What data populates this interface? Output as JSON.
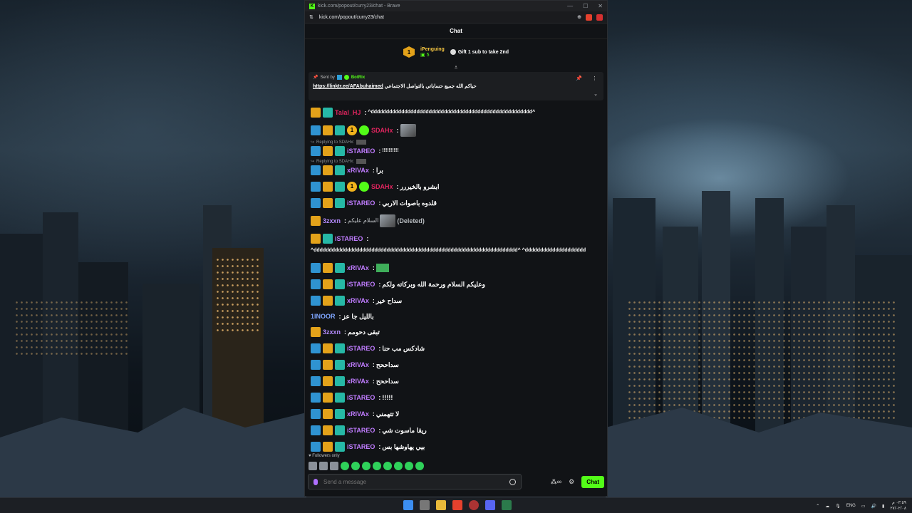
{
  "browser": {
    "title": "kick.com/popout/curry23/chat - Brave",
    "url": "kick.com/popout/curry23/chat",
    "controls": [
      "—",
      "☐",
      "✕"
    ]
  },
  "chat": {
    "header": "Chat",
    "leaderboard": {
      "rank": "1",
      "name": "iPenguing",
      "count": "5",
      "gift_text": "Gift 1 sub to take 2nd"
    },
    "pinned": {
      "sent_by_label": "Sent by",
      "sender": "BotRix",
      "message": "حياكم الله جميع حساباتي بالتواصل الاجتماعي",
      "link": "https://linktr.ee/AFAbuhaimed"
    },
    "messages": [
      {
        "user": "Talal_HJ",
        "color": "#e0245e",
        "text": "^ddddddddddddddddddddddddddddddddddddddddddddddddddddd^"
      },
      {
        "user": "SDAHx",
        "color": "#e0245e",
        "text": ""
      },
      {
        "reply": "Replying to SDAHx:",
        "user": "iSTAREO",
        "color": "#c07cff",
        "text": "!!!!!!!!!!"
      },
      {
        "reply": "Replying to SDAHx:",
        "user": "xRIVAx",
        "color": "#c07cff",
        "text": "برا"
      },
      {
        "user": "SDAHx",
        "color": "#e0245e",
        "text": "ابشرو بالخيررر"
      },
      {
        "user": "iSTAREO",
        "color": "#c07cff",
        "text": "قلدوه باصوات الاربي"
      },
      {
        "user": "3zxxn",
        "color": "#b68cff",
        "text": "السلام عليكم",
        "deleted": "(Deleted)"
      },
      {
        "user": "iSTAREO",
        "color": "#c07cff",
        "text": "^ddddddddddddddddddddddddddddddddddddddddddddddddddddddddddddddddddd^ ^dddddddddddddddddddd"
      },
      {
        "user": "xRIVAx",
        "color": "#c07cff",
        "text": ""
      },
      {
        "user": "iSTAREO",
        "color": "#c07cff",
        "text": "وعليكم السلام ورحمة الله وبركاته ولكم"
      },
      {
        "user": "xRIVAx",
        "color": "#c07cff",
        "text": "سداح خير"
      },
      {
        "user": "1INOOR",
        "color": "#7fa6ff",
        "text": "بالليل جا عز"
      },
      {
        "user": "3zxxn",
        "color": "#b68cff",
        "text": "تبقى دحومم"
      },
      {
        "user": "iSTAREO",
        "color": "#c07cff",
        "text": "شادكس مب حنا"
      },
      {
        "user": "xRIVAx",
        "color": "#c07cff",
        "text": "سداححح"
      },
      {
        "user": "xRIVAx",
        "color": "#c07cff",
        "text": "سداححح"
      },
      {
        "user": "iSTAREO",
        "color": "#c07cff",
        "text": "!!!!!"
      },
      {
        "user": "xRIVAx",
        "color": "#c07cff",
        "text": "لا تتهمني"
      },
      {
        "user": "iSTAREO",
        "color": "#c07cff",
        "text": "ريقا ماسوت شي"
      },
      {
        "user": "iSTAREO",
        "color": "#c07cff",
        "text": "بيي يهاوشها بس"
      }
    ],
    "followers_only": "Followers only",
    "input_placeholder": "Send a message",
    "infinity_label": "∞",
    "send_label": "Chat"
  },
  "taskbar": {
    "lang": "ENG",
    "time": "٠٣:٥٩ م",
    "date": "٢٧/٠٢/٠٨"
  }
}
